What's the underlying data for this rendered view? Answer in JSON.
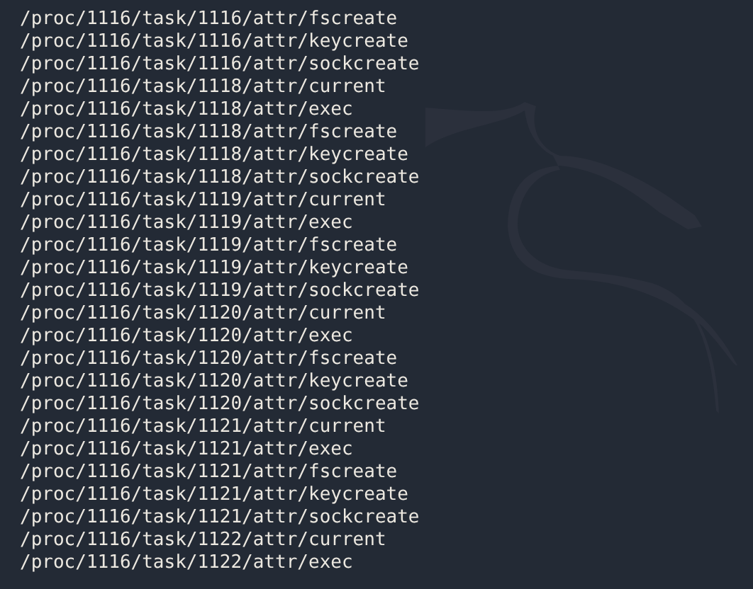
{
  "terminal": {
    "lines": [
      "/proc/1116/task/1116/attr/fscreate",
      "/proc/1116/task/1116/attr/keycreate",
      "/proc/1116/task/1116/attr/sockcreate",
      "/proc/1116/task/1118/attr/current",
      "/proc/1116/task/1118/attr/exec",
      "/proc/1116/task/1118/attr/fscreate",
      "/proc/1116/task/1118/attr/keycreate",
      "/proc/1116/task/1118/attr/sockcreate",
      "/proc/1116/task/1119/attr/current",
      "/proc/1116/task/1119/attr/exec",
      "/proc/1116/task/1119/attr/fscreate",
      "/proc/1116/task/1119/attr/keycreate",
      "/proc/1116/task/1119/attr/sockcreate",
      "/proc/1116/task/1120/attr/current",
      "/proc/1116/task/1120/attr/exec",
      "/proc/1116/task/1120/attr/fscreate",
      "/proc/1116/task/1120/attr/keycreate",
      "/proc/1116/task/1120/attr/sockcreate",
      "/proc/1116/task/1121/attr/current",
      "/proc/1116/task/1121/attr/exec",
      "/proc/1116/task/1121/attr/fscreate",
      "/proc/1116/task/1121/attr/keycreate",
      "/proc/1116/task/1121/attr/sockcreate",
      "/proc/1116/task/1122/attr/current",
      "/proc/1116/task/1122/attr/exec"
    ]
  }
}
